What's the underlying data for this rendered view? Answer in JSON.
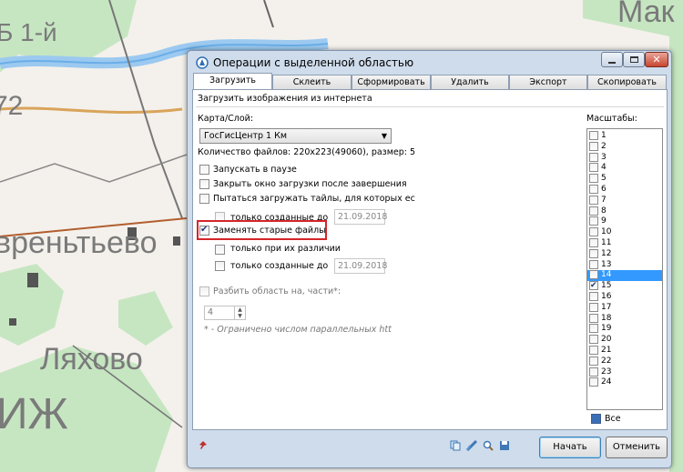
{
  "map": {
    "labels": [
      "Мак",
      "Б 1-й",
      "72",
      "вреньтьево",
      "Ляхово",
      "ИЖ"
    ]
  },
  "dialog": {
    "title": "Операции с выделенной областью",
    "tabs": [
      "Загрузить",
      "Склеить",
      "Сформировать",
      "Удалить",
      "Экспорт",
      "Скопировать"
    ],
    "active_tab": "Загрузить",
    "section_title": "Загрузить изображения из интернета",
    "map_layer_label": "Карта/Слой:",
    "map_layer_value": "ГосГисЦентр 1 Км",
    "files_count": "Количество файлов: 220x223(49060), размер: 5",
    "options": {
      "pause_label": "Запускать в паузе",
      "close_label": "Закрыть окно загрузки после завершения",
      "retry_label": "Пытаться загружать тайлы, для которых ес",
      "created_before_label": "только созданные до",
      "created_before_date": "21.09.2018",
      "replace_label": "Заменять старые файлы",
      "replace_checked": true,
      "only_diff_label": "только при их различии",
      "created_before2_label": "только созданные до",
      "created_before2_date": "21.09.2018",
      "split_label": "Разбить область на, части*:",
      "split_value": "4",
      "note": "* - Ограничено числом параллельных htt"
    },
    "scales_title": "Масштабы:",
    "scales": [
      {
        "n": "1",
        "checked": false,
        "selected": false
      },
      {
        "n": "2",
        "checked": false,
        "selected": false
      },
      {
        "n": "3",
        "checked": false,
        "selected": false
      },
      {
        "n": "4",
        "checked": false,
        "selected": false
      },
      {
        "n": "5",
        "checked": false,
        "selected": false
      },
      {
        "n": "6",
        "checked": false,
        "selected": false
      },
      {
        "n": "7",
        "checked": false,
        "selected": false
      },
      {
        "n": "8",
        "checked": false,
        "selected": false
      },
      {
        "n": "9",
        "checked": false,
        "selected": false
      },
      {
        "n": "10",
        "checked": false,
        "selected": false
      },
      {
        "n": "11",
        "checked": false,
        "selected": false
      },
      {
        "n": "12",
        "checked": false,
        "selected": false
      },
      {
        "n": "13",
        "checked": false,
        "selected": false
      },
      {
        "n": "14",
        "checked": false,
        "selected": true
      },
      {
        "n": "15",
        "checked": true,
        "selected": false
      },
      {
        "n": "16",
        "checked": false,
        "selected": false
      },
      {
        "n": "17",
        "checked": false,
        "selected": false
      },
      {
        "n": "18",
        "checked": false,
        "selected": false
      },
      {
        "n": "19",
        "checked": false,
        "selected": false
      },
      {
        "n": "20",
        "checked": false,
        "selected": false
      },
      {
        "n": "21",
        "checked": false,
        "selected": false
      },
      {
        "n": "22",
        "checked": false,
        "selected": false
      },
      {
        "n": "23",
        "checked": false,
        "selected": false
      },
      {
        "n": "24",
        "checked": false,
        "selected": false
      }
    ],
    "all_label": "Все",
    "start_button": "Начать",
    "cancel_button": "Отменить"
  },
  "colors": {
    "highlight": "#d4262a",
    "selection": "#3399ff"
  }
}
